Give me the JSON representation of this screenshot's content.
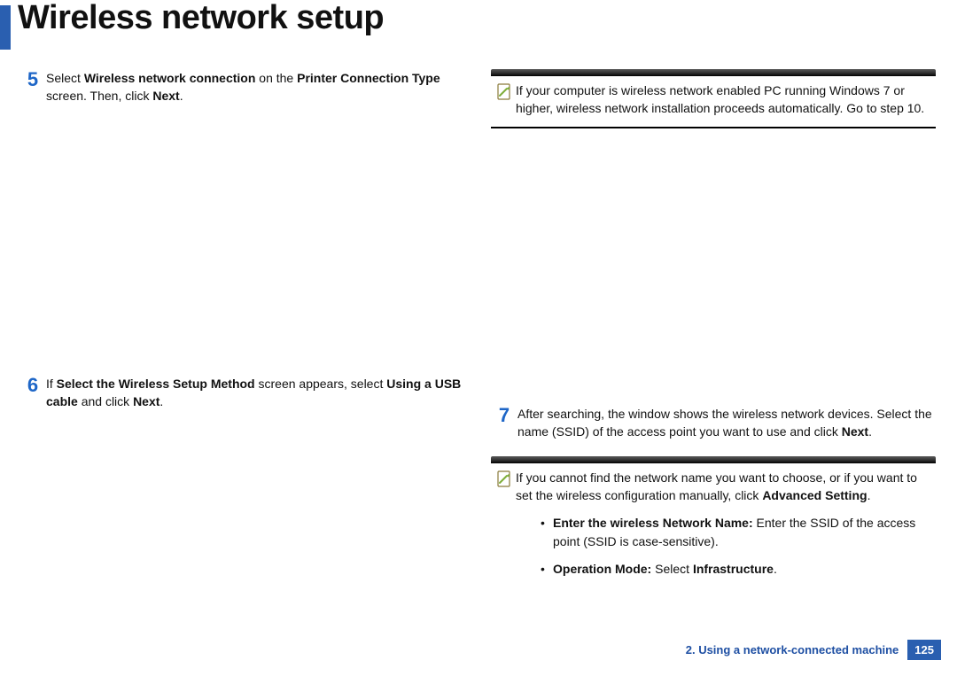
{
  "title": "Wireless network setup",
  "left": {
    "step5": {
      "num": "5",
      "t1": "Select ",
      "b1": "Wireless network connection",
      "t2": " on the ",
      "b2": "Printer Connection Type",
      "t3": " screen. Then, click ",
      "b3": "Next",
      "t4": "."
    },
    "step6": {
      "num": "6",
      "t1": "If ",
      "b1": "Select the Wireless Setup Method",
      "t2": " screen appears, select ",
      "b2": "Using a USB cable",
      "t3": " and click ",
      "b3": "Next",
      "t4": "."
    }
  },
  "right": {
    "note1": {
      "text": "If your computer is wireless network enabled PC running Windows 7 or higher, wireless network installation proceeds automatically. Go to step 10."
    },
    "step7": {
      "num": "7",
      "t1": "After searching, the window shows the wireless network devices. Select the name (SSID) of the access point you want to use and click ",
      "b1": "Next",
      "t2": "."
    },
    "note2": {
      "t1": "If you cannot find the network name you want to choose, or if you want to set the wireless configuration manually, click ",
      "b1": "Advanced Setting",
      "t2": "."
    },
    "bullets": {
      "i0": {
        "b": "Enter the wireless Network Name:",
        "t": " Enter the SSID of the access point (SSID is case-sensitive)."
      },
      "i1": {
        "b": "Operation Mode:",
        "t1": " Select ",
        "b2": "Infrastructure",
        "t2": "."
      }
    }
  },
  "footer": {
    "chapter": "2.  Using a network-connected machine",
    "page": "125"
  }
}
